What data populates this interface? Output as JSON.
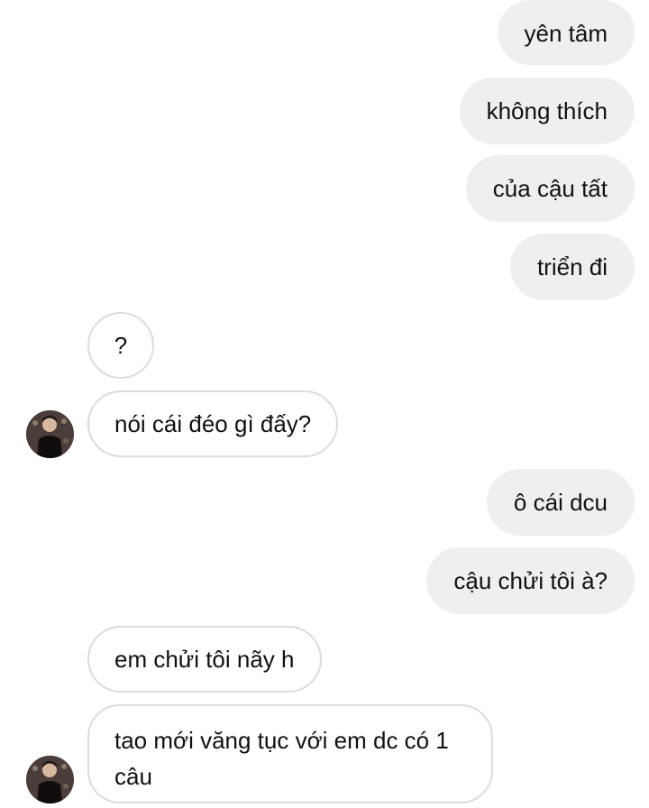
{
  "thread": {
    "messages": [
      {
        "side": "out",
        "text": "yên tâm"
      },
      {
        "side": "out",
        "text": "không thích"
      },
      {
        "side": "out",
        "text": "của cậu tất"
      },
      {
        "side": "out",
        "text": "triển đi"
      },
      {
        "side": "in",
        "text": "?"
      },
      {
        "side": "in",
        "text": "nói cái đéo gì đấy?"
      },
      {
        "side": "out",
        "text": "ô cái dcu"
      },
      {
        "side": "out",
        "text": "cậu chửi tôi à?"
      },
      {
        "side": "in",
        "text": "em chửi tôi nãy h"
      },
      {
        "side": "in",
        "text": "tao mới văng tục với em dc có 1 câu"
      }
    ]
  },
  "colors": {
    "outgoing_bubble": "#efefef",
    "incoming_border": "#dcdcdc",
    "text": "#111111"
  },
  "icons": {
    "contact_avatar": "avatar-photo"
  }
}
